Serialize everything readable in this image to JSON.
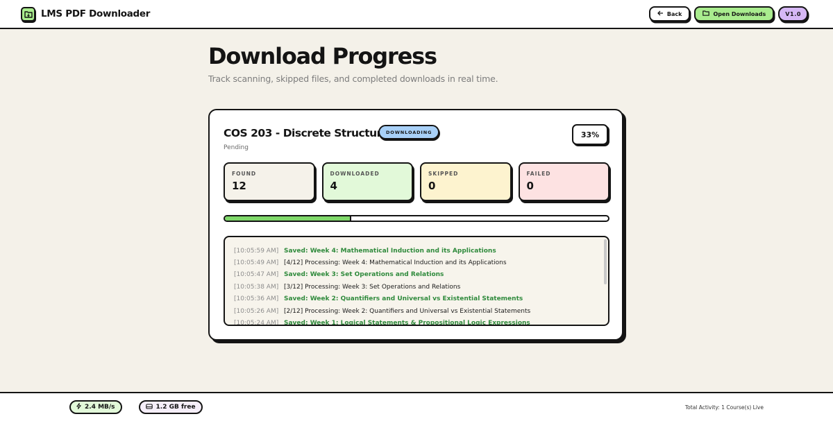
{
  "app": {
    "title": "LMS PDF Downloader"
  },
  "header": {
    "back_label": "Back",
    "open_downloads_label": "Open Downloads",
    "version_label": "V1.0"
  },
  "page": {
    "title": "Download Progress",
    "subtitle": "Track scanning, skipped files, and completed downloads in real time."
  },
  "course": {
    "name": "COS 203 - Discrete Structures",
    "status": "DOWNLOADING",
    "substatus": "Pending",
    "percent_label": "33%",
    "progress": 0.33,
    "stats": {
      "found_label": "FOUND",
      "found": "12",
      "downloaded_label": "DOWNLOADED",
      "downloaded": "4",
      "skipped_label": "SKIPPED",
      "skipped": "0",
      "failed_label": "FAILED",
      "failed": "0"
    }
  },
  "log": [
    {
      "time": "[10:05:59 AM]",
      "message": "Saved: Week 4: Mathematical Induction and its Applications",
      "kind": "saved"
    },
    {
      "time": "[10:05:49 AM]",
      "message": "[4/12] Processing: Week 4: Mathematical Induction and its Applications",
      "kind": "processing"
    },
    {
      "time": "[10:05:47 AM]",
      "message": "Saved: Week 3: Set Operations and Relations",
      "kind": "saved"
    },
    {
      "time": "[10:05:38 AM]",
      "message": "[3/12] Processing: Week 3: Set Operations and Relations",
      "kind": "processing"
    },
    {
      "time": "[10:05:36 AM]",
      "message": "Saved: Week 2: Quantifiers and Universal vs Existential Statements",
      "kind": "saved"
    },
    {
      "time": "[10:05:26 AM]",
      "message": "[2/12] Processing: Week 2: Quantifiers and Universal vs Existential Statements",
      "kind": "processing"
    },
    {
      "time": "[10:05:24 AM]",
      "message": "Saved: Week 1: Logical Statements & Propositional Logic Expressions",
      "kind": "saved"
    }
  ],
  "footer": {
    "speed": "2.4 MB/s",
    "disk": "1.2 GB free",
    "activity": "Total Activity: 1 Course(s) Live"
  },
  "icons": {
    "brand": "folder-download-icon",
    "back": "arrow-left-icon",
    "open_downloads": "folder-icon",
    "speed": "lightning-icon",
    "disk": "hard-drive-icon"
  },
  "colors": {
    "accent_green": "#a9ec8e",
    "badge_blue": "#a8d0f7",
    "version_purple": "#d6b7f5",
    "saved_text": "#2f8a3c"
  }
}
